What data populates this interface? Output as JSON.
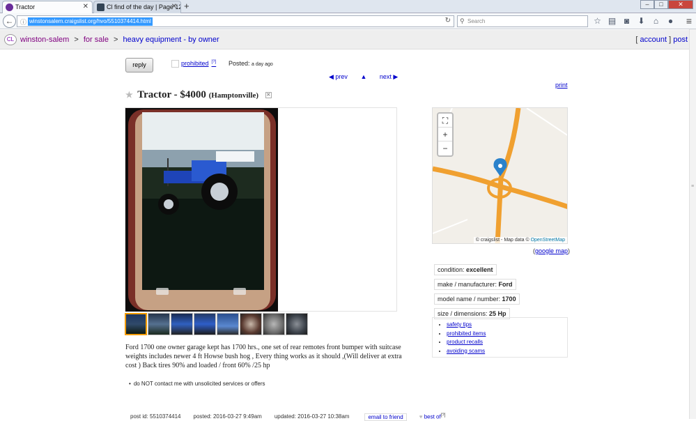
{
  "browser": {
    "tabs": [
      {
        "title": "Tractor",
        "active": true
      },
      {
        "title": "Cl find of the day | Page 12...",
        "active": false
      }
    ],
    "url": "winstonsalem.craigslist.org/hvo/5510374414.html",
    "search_placeholder": "Search",
    "new_tab": "+"
  },
  "header": {
    "logo": "CL",
    "breadcrumbs": [
      "winston-salem",
      "for sale",
      "heavy equipment - by owner"
    ],
    "breadcrumb_sep": ">",
    "account_label": "account",
    "post_label": "post"
  },
  "actions": {
    "reply_label": "reply",
    "prohibited_label": "prohibited",
    "prohibited_help": "[?]",
    "posted_label": "Posted:",
    "posted_value": "a day ago",
    "prev_label": "◀ prev",
    "up_label": "▲",
    "next_label": "next ▶",
    "print_label": "print"
  },
  "posting": {
    "title": "Tractor - $4000",
    "location": "(Hamptonville)",
    "body": "Ford 1700 one owner garage kept has 1700 hrs., one set of rear remotes front bumper with suitcase weights includes newer 4 ft Howse bush hog , Every thing works as it should ,(Will deliver at extra cost ) Back tires 90% and loaded / front 60% /25 hp",
    "notice": "do NOT contact me with unsolicited services or offers",
    "thumb_count": 8
  },
  "map": {
    "attribution_prefix": "© craigslist - Map data © ",
    "attribution_link": "OpenStreetMap",
    "google_map_label": "google map",
    "controls": [
      "⛶",
      "+",
      "−"
    ]
  },
  "attributes": [
    {
      "label": "condition: ",
      "value": "excellent"
    },
    {
      "label": "make / manufacturer: ",
      "value": "Ford"
    },
    {
      "label": "model name / number: ",
      "value": "1700"
    },
    {
      "label": "size / dimensions: ",
      "value": "25 Hp"
    }
  ],
  "safety_links": [
    "safety tips",
    "prohibited items",
    "product recalls",
    "avoiding scams"
  ],
  "footer": {
    "post_id": "post id: 5510374414",
    "posted": "posted: 2016-03-27 9:49am",
    "updated": "updated: 2016-03-27 10:38am",
    "email_label": "email to friend",
    "best_of_label": "best of",
    "best_of_help": "[?]"
  },
  "colors": {
    "link": "#0000cc",
    "breadcrumb": "#800080",
    "highway": "#f0a030",
    "selected_thumb": "#f39c00"
  }
}
